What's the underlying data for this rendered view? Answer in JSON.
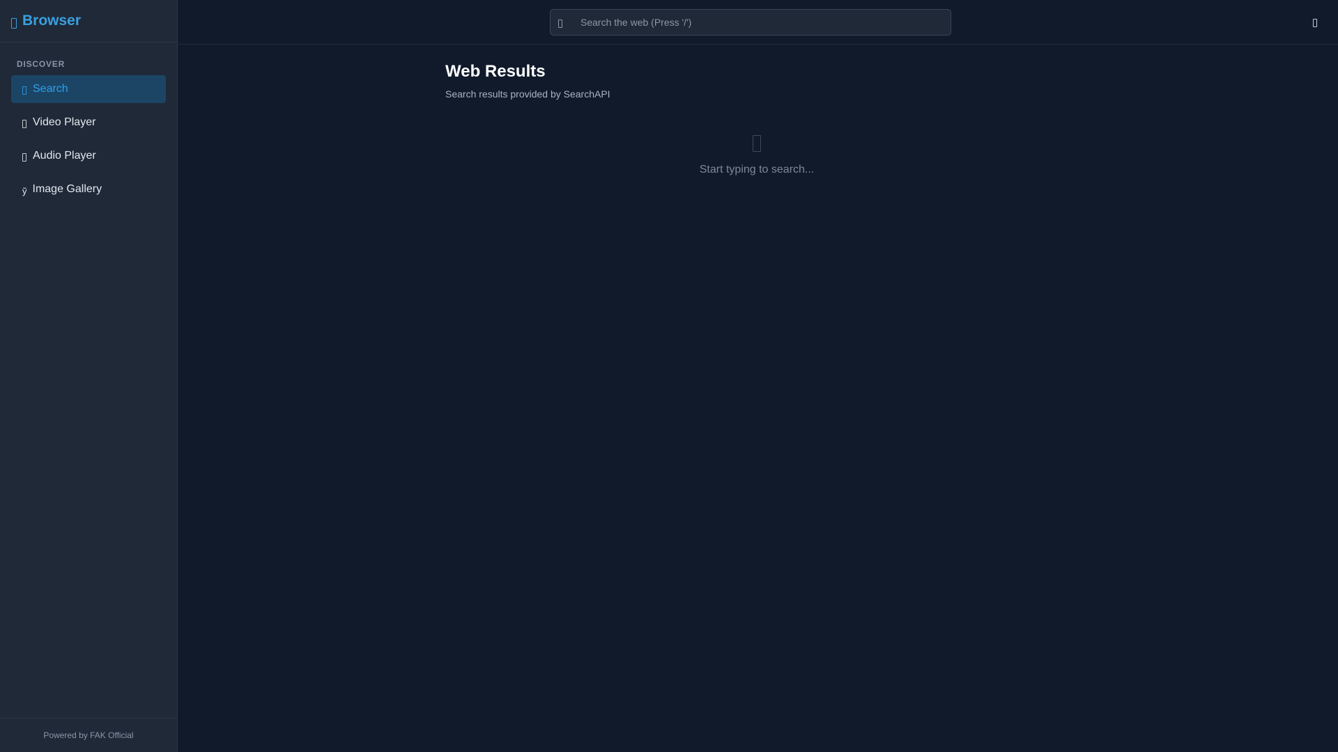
{
  "app": {
    "title": "Browser"
  },
  "sidebar": {
    "section_label": "DISCOVER",
    "items": [
      {
        "label": "Search",
        "icon": "search-icon",
        "active": true
      },
      {
        "label": "Video Player",
        "icon": "video-icon",
        "active": false
      },
      {
        "label": "Audio Player",
        "icon": "audio-icon",
        "active": false
      },
      {
        "label": "Image Gallery",
        "icon": "image-icon",
        "active": false
      }
    ],
    "footer": "Powered by FAK Official"
  },
  "search": {
    "placeholder": "Search the web (Press '/')",
    "value": ""
  },
  "main": {
    "title": "Web Results",
    "subtitle": "Search results provided by SearchAPI",
    "empty_message": "Start typing to search..."
  },
  "colors": {
    "background": "#111a2b",
    "sidebar": "#1f2937",
    "accent": "#2ea0eb",
    "active_item_bg": "#1c4565"
  }
}
